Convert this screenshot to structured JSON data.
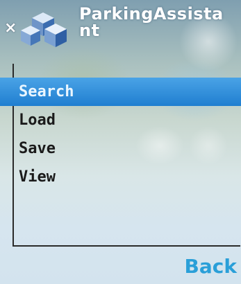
{
  "header": {
    "title": "ParkingAssistant",
    "close_glyph": "×"
  },
  "menu": {
    "items": [
      {
        "label": "Search",
        "selected": true
      },
      {
        "label": "Load",
        "selected": false
      },
      {
        "label": "Save",
        "selected": false
      },
      {
        "label": "View",
        "selected": false
      }
    ]
  },
  "softkeys": {
    "right": "Back"
  },
  "colors": {
    "accent": "#2a9fd8",
    "selection": "#1f7ed0"
  },
  "icons": {
    "app": "puzzle-blocks-icon"
  }
}
